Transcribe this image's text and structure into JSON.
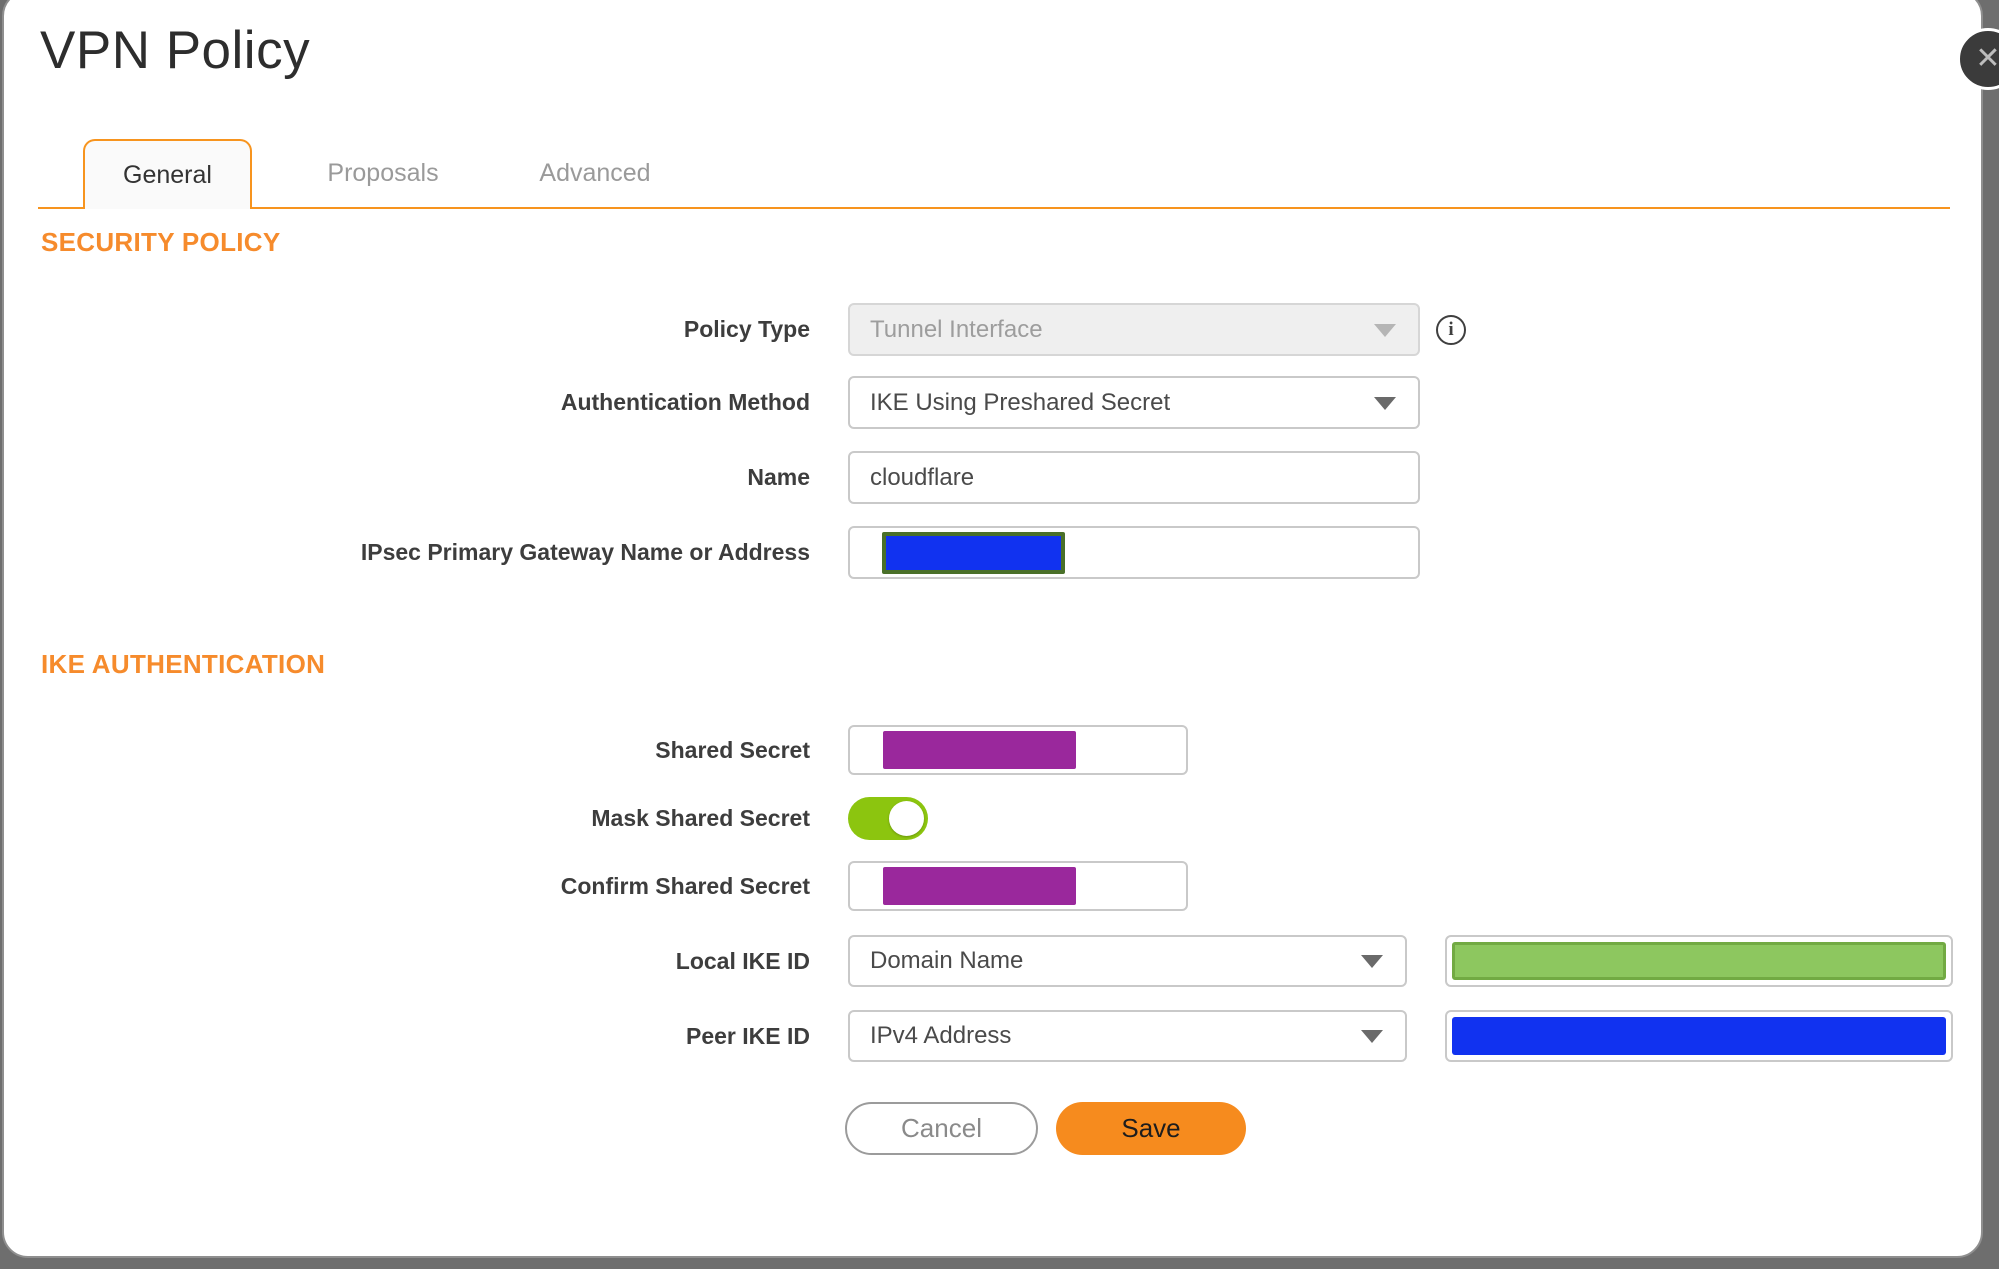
{
  "window": {
    "title": "VPN Policy"
  },
  "tabs": [
    {
      "label": "General",
      "active": true
    },
    {
      "label": "Proposals",
      "active": false
    },
    {
      "label": "Advanced",
      "active": false
    }
  ],
  "security_policy": {
    "heading": "SECURITY POLICY",
    "policy_type": {
      "label": "Policy Type",
      "value": "Tunnel Interface",
      "disabled": true
    },
    "authentication_method": {
      "label": "Authentication Method",
      "value": "IKE Using Preshared Secret"
    },
    "name": {
      "label": "Name",
      "value": "cloudflare"
    },
    "gateway": {
      "label": "IPsec Primary Gateway Name or Address",
      "value_redacted": true,
      "redaction_color": "#1132f0",
      "redaction_border": "#4a7029"
    }
  },
  "ike_authentication": {
    "heading": "IKE AUTHENTICATION",
    "shared_secret": {
      "label": "Shared Secret",
      "value_redacted": true,
      "redaction_color": "#9a289c"
    },
    "mask_shared_secret": {
      "label": "Mask Shared Secret",
      "enabled": true
    },
    "confirm_shared_secret": {
      "label": "Confirm Shared Secret",
      "value_redacted": true,
      "redaction_color": "#9a289c"
    },
    "local_ike_id": {
      "label": "Local IKE ID",
      "value": "Domain Name",
      "id_value_redacted": true,
      "redaction_color": "#8dc75f",
      "redaction_border": "#72aa43"
    },
    "peer_ike_id": {
      "label": "Peer IKE ID",
      "value": "IPv4 Address",
      "id_value_redacted": true,
      "redaction_color": "#1132f0"
    }
  },
  "actions": {
    "cancel": "Cancel",
    "save": "Save"
  },
  "icons": {
    "close": "✕",
    "info": "i"
  },
  "colors": {
    "accent_orange": "#f7941e",
    "heading_orange": "#f68b2c",
    "save_orange": "#f68b1e",
    "toggle_green": "#8cc50f",
    "redact_purple": "#9a289c",
    "redact_blue": "#1132f0",
    "redact_green_fill": "#8dc75f",
    "redact_green_border": "#72aa43",
    "gateway_border_olive": "#4a7029",
    "backdrop_gray": "#6e6e6e",
    "disabled_field_bg": "#efefef"
  }
}
